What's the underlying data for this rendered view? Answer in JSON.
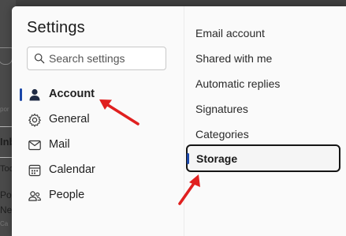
{
  "background_app": {
    "fragments": [
      "por",
      "Inb",
      "Too",
      "Po",
      "Ne",
      "Ca"
    ]
  },
  "settings": {
    "title": "Settings",
    "search": {
      "placeholder": "Search settings",
      "value": ""
    },
    "nav": [
      {
        "label": "Account",
        "icon": "person-icon",
        "selected": true
      },
      {
        "label": "General",
        "icon": "gear-icon",
        "selected": false
      },
      {
        "label": "Mail",
        "icon": "envelope-icon",
        "selected": false
      },
      {
        "label": "Calendar",
        "icon": "calendar-icon",
        "selected": false
      },
      {
        "label": "People",
        "icon": "people-icon",
        "selected": false
      }
    ],
    "account_subsections": [
      {
        "label": "Email account",
        "selected": false
      },
      {
        "label": "Shared with me",
        "selected": false
      },
      {
        "label": "Automatic replies",
        "selected": false
      },
      {
        "label": "Signatures",
        "selected": false
      },
      {
        "label": "Categories",
        "selected": false
      },
      {
        "label": "Storage",
        "selected": true
      }
    ]
  },
  "colors": {
    "accent": "#1a46a8",
    "annotation_arrow": "#e0201f",
    "panel_background": "#fafafa"
  }
}
